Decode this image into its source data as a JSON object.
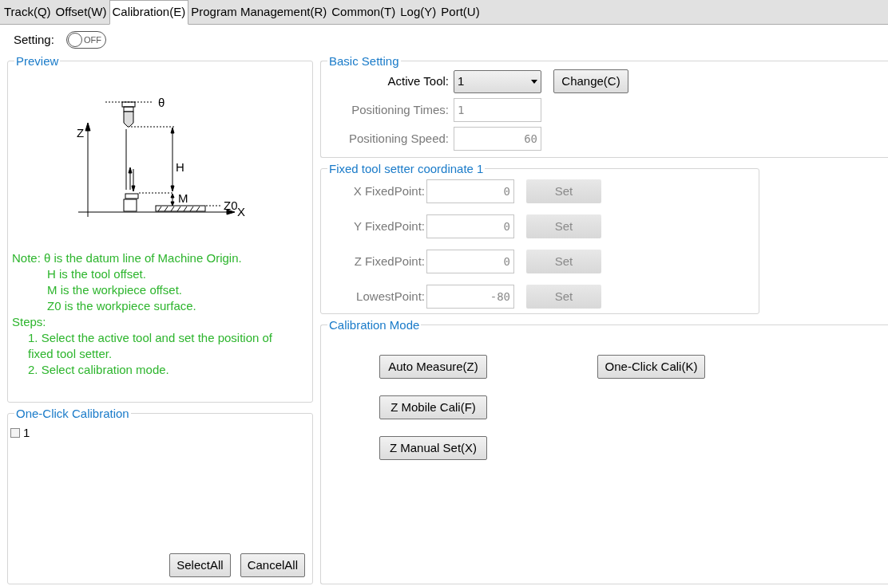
{
  "tabs": [
    {
      "label": "Track(Q)",
      "selected": false
    },
    {
      "label": "Offset(W)",
      "selected": false
    },
    {
      "label": "Calibration(E)",
      "selected": true
    },
    {
      "label": "Program Management(R)",
      "selected": false
    },
    {
      "label": "Common(T)",
      "selected": false
    },
    {
      "label": "Log(Y)",
      "selected": false
    },
    {
      "label": "Port(U)",
      "selected": false
    }
  ],
  "setting": {
    "label": "Setting:",
    "on": false,
    "state_text": "OFF"
  },
  "preview": {
    "title": "Preview",
    "diagram_labels": {
      "z_axis": "Z",
      "datum": "θ",
      "h": "H",
      "m": "M",
      "z0": "Z0",
      "x_axis": "X"
    },
    "note_lines": [
      "Note: θ is the datum line of Machine Origin.",
      "H is the tool offset.",
      "M is the workpiece offset.",
      "Z0 is the workpiece surface."
    ],
    "steps_title": "Steps:",
    "steps": [
      "1. Select the active tool and set the position of fixed tool setter.",
      "2. Select calibration mode."
    ]
  },
  "one_click": {
    "title": "One-Click Calibration",
    "items": [
      {
        "label": "1",
        "checked": false
      }
    ],
    "buttons": [
      "SelectAll",
      "CancelAll"
    ]
  },
  "basic_setting": {
    "title": "Basic Setting",
    "active_tool": {
      "label": "Active Tool:",
      "value": "1"
    },
    "change_button": "Change(C)",
    "fields": [
      {
        "label": "Positioning Times:",
        "value": "1",
        "disabled": true
      },
      {
        "label": "Positioning Speed:",
        "value": "60",
        "disabled": true
      }
    ]
  },
  "fixed_setter": {
    "title": "Fixed tool setter coordinate 1",
    "rows": [
      {
        "label": "X FixedPoint:",
        "value": "0",
        "button": "Set",
        "disabled": true
      },
      {
        "label": "Y FixedPoint:",
        "value": "0",
        "button": "Set",
        "disabled": true
      },
      {
        "label": "Z FixedPoint:",
        "value": "0",
        "button": "Set",
        "disabled": true
      },
      {
        "label": "LowestPoint:",
        "value": "-80",
        "button": "Set",
        "disabled": true
      }
    ]
  },
  "calibration_mode": {
    "title": "Calibration Mode",
    "buttons": [
      "Auto Measure(Z)",
      "One-Click Cali(K)",
      "Z Mobile Cali(F)",
      "Z Manual Set(X)"
    ]
  }
}
